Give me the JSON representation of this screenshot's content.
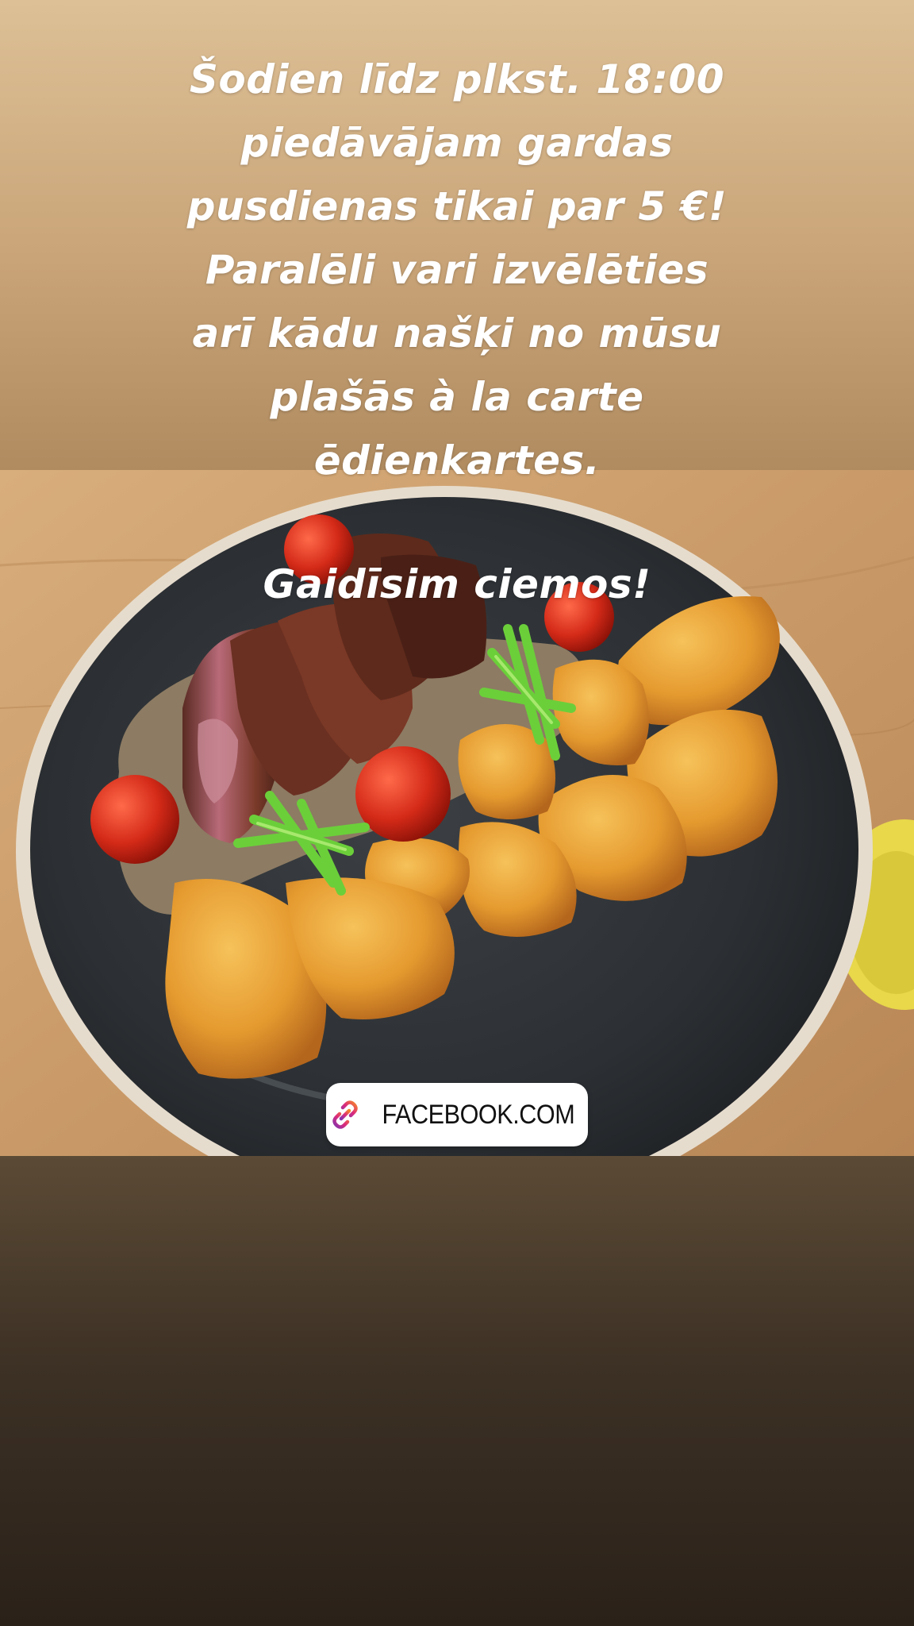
{
  "story": {
    "caption_main": "Šodien līdz plkst. 18:00\npiedāvājam gardas\npusdienas tikai par 5 €!\nParalēli vari izvēlēties\narī kādu našķi no mūsu\nplašās à la carte\nēdienkartes.",
    "caption_welcome": "Gaidīsim ciemos!",
    "link_sticker": {
      "label": "FACEBOOK.COM",
      "icon": "link-chain-icon"
    }
  },
  "colors": {
    "top_gradient": "#d9b98f",
    "bottom_gradient": "#2a2119",
    "caption_text": "#ffffff",
    "sticker_bg": "#ffffff",
    "icon_gradient_start": "#f58529",
    "icon_gradient_end": "#8134af"
  }
}
